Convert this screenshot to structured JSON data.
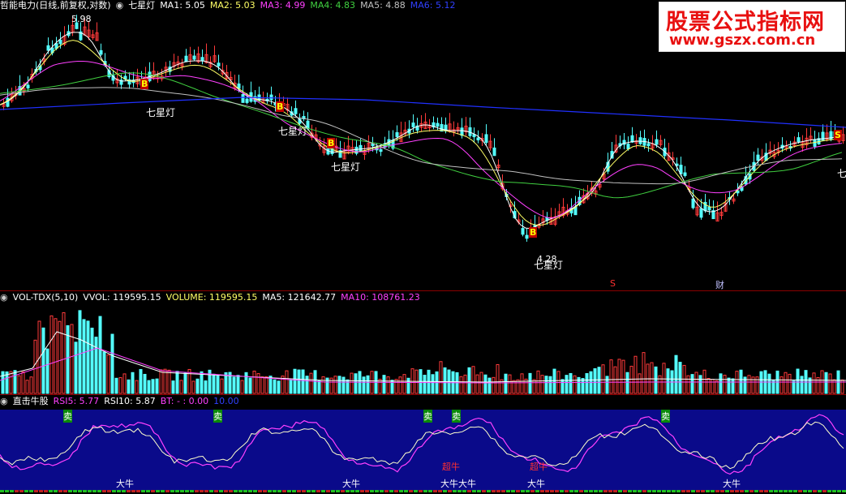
{
  "main_header": {
    "title": "哲能电力(日线,前复权,对数)",
    "indicator": "七星灯",
    "ma1": "MA1: 5.05",
    "ma2": "MA2: 5.03",
    "ma3": "MA3: 4.99",
    "ma4": "MA4: 4.83",
    "ma5": "MA5: 4.88",
    "ma6": "MA6: 5.12"
  },
  "volume_header": {
    "name": "VOL-TDX(5,10)",
    "vvol": "VVOL: 119595.15",
    "volume": "VOLUME: 119595.15",
    "ma5": "MA5: 121642.77",
    "ma10": "MA10: 108761.23"
  },
  "indicator_header": {
    "name": "直击牛股",
    "rsi5": "RSI5: 5.77",
    "rsi10": "RSI10: 5.87",
    "bt": "BT: - : 0.00",
    "extra": "10.00"
  },
  "price_labels": {
    "high": "5.98",
    "low": "4.28",
    "buy_marker": "B",
    "sell_marker": "S",
    "event_s": "S",
    "event_cai": "财",
    "qixingdeng_1": "七星灯",
    "qixingdeng_2": "七星灯",
    "qixingdeng_3": "七星灯",
    "qixingdeng_4": "七星灯",
    "right_edge": "七"
  },
  "indicator_labels": {
    "sell": "卖",
    "big_bull": "大牛",
    "super_bull": "超牛",
    "big_bull_double": "大牛大牛"
  },
  "watermark": {
    "title": "股票公式指标网",
    "url": "www.gszx.com.cn"
  },
  "colors": {
    "up": "#ff3a3a",
    "down": "#54ffff",
    "ma1": "#ffffff",
    "ma2": "#ffff66",
    "ma3": "#ff40ff",
    "ma4": "#40d040",
    "ma5": "#c0c0c0",
    "ma6": "#2030ff",
    "ind_bg": "#0a0a8a"
  }
}
